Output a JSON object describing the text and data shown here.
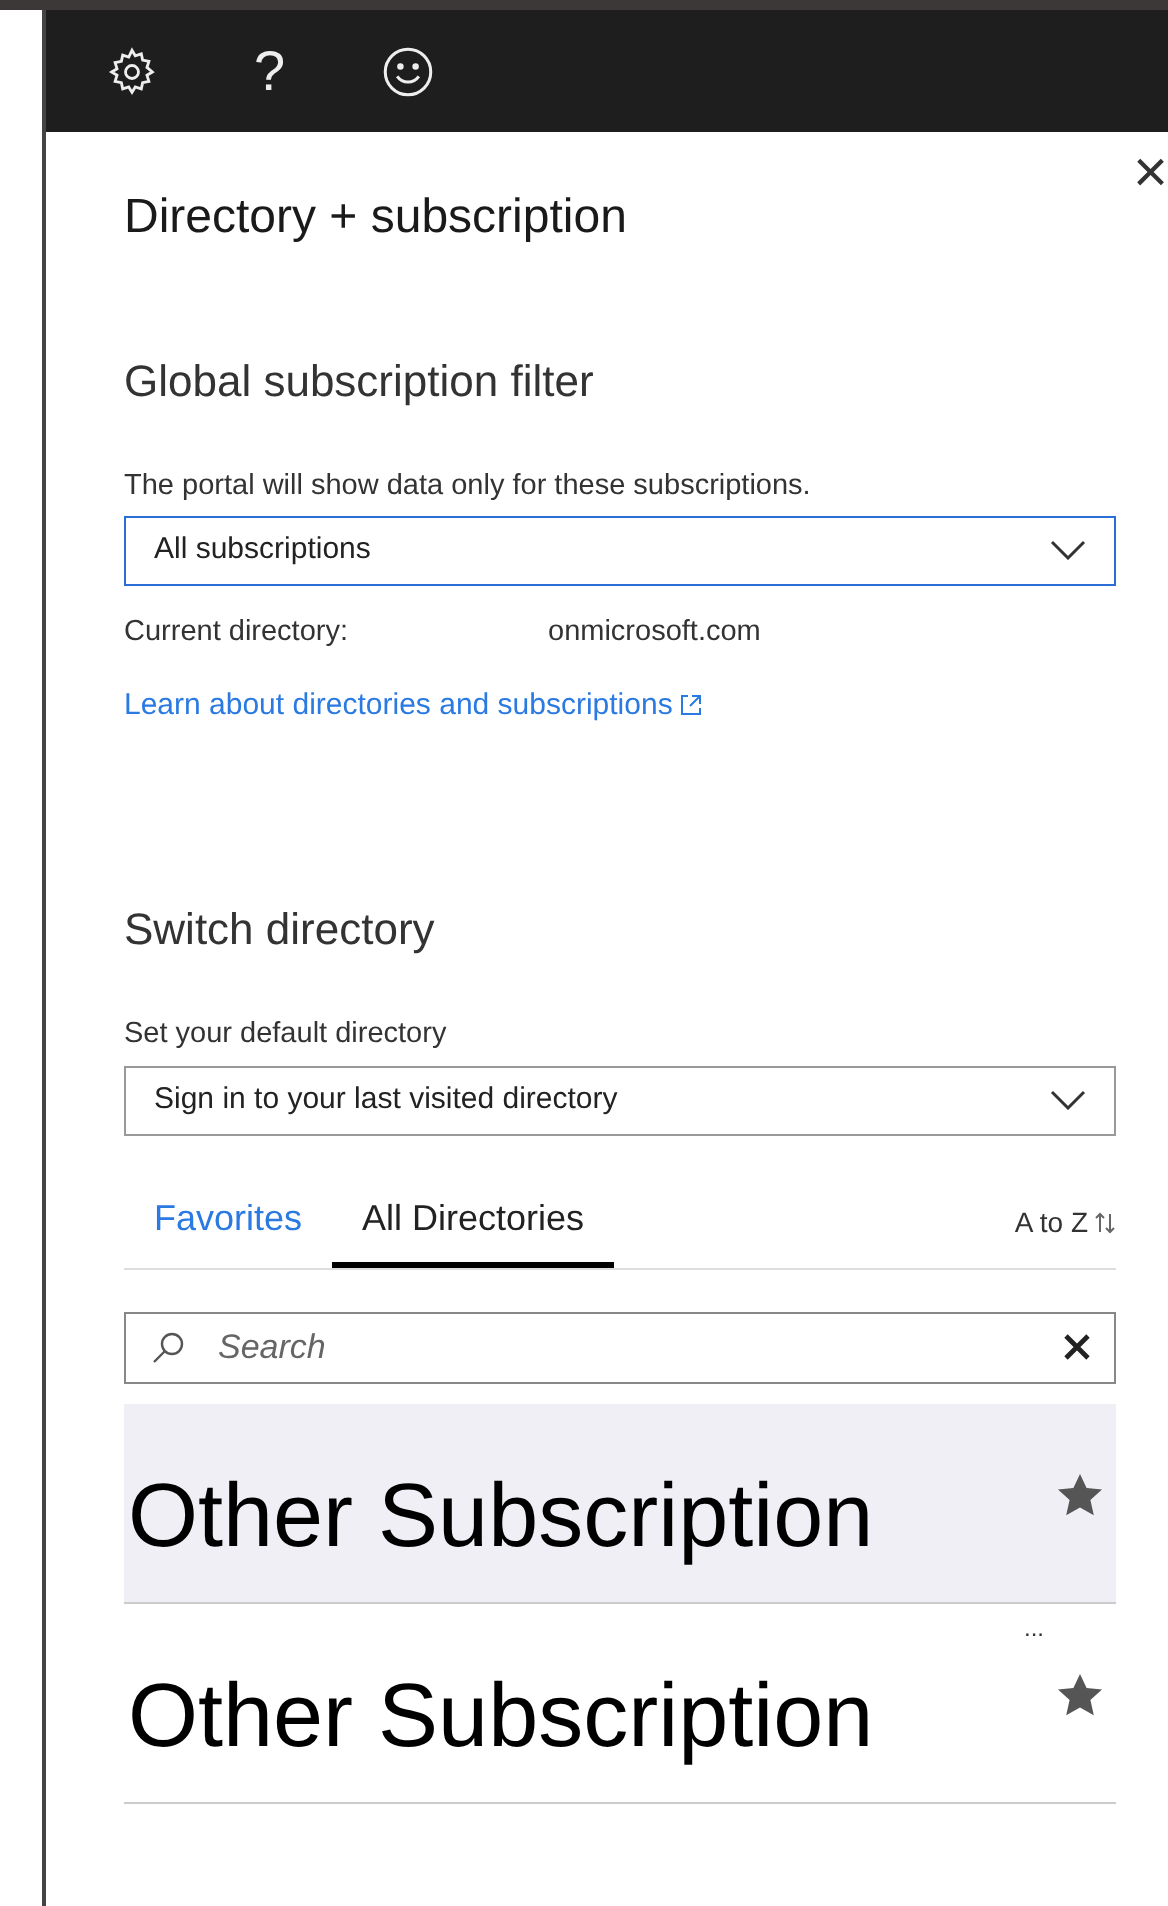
{
  "toolbar": {
    "help_text": "?"
  },
  "panel": {
    "title": "Directory + subscription",
    "close_text": "×"
  },
  "subscription_filter": {
    "heading": "Global subscription filter",
    "description": "The portal will show data only for these subscriptions.",
    "value": "All subscriptions",
    "current_directory_label": "Current directory:",
    "current_directory_value": "onmicrosoft.com",
    "link": "Learn about directories and subscriptions"
  },
  "switch_directory": {
    "heading": "Switch directory",
    "default_label": "Set your default directory",
    "default_value": "Sign in to your last visited directory"
  },
  "tabs": [
    {
      "label": "Favorites",
      "selected": false
    },
    {
      "label": "All Directories",
      "selected": true
    }
  ],
  "sort": "A to Z",
  "search": {
    "placeholder": "Search"
  },
  "directories": [
    {
      "name": "Other Subscription",
      "selected": true
    },
    {
      "name": "Other Subscription",
      "selected": false,
      "more": "..."
    }
  ]
}
